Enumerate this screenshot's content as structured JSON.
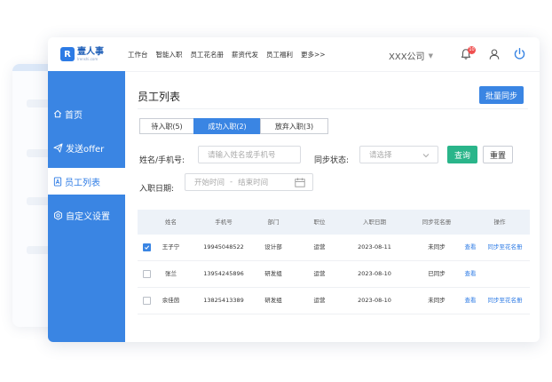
{
  "brand": {
    "name_cn": "壹人事",
    "name_en": "Irenshi.com",
    "mark": "R"
  },
  "nav": [
    "工作台",
    "智能入职",
    "员工花名册",
    "薪资代发",
    "员工福利",
    "更多>>"
  ],
  "company": "XXX公司",
  "notification_count": "10",
  "sidebar": [
    {
      "label": "首页",
      "icon": "home-icon"
    },
    {
      "label": "发送offer",
      "icon": "send-icon"
    },
    {
      "label": "员工列表",
      "icon": "document-icon"
    },
    {
      "label": "自定义设置",
      "icon": "settings-icon"
    }
  ],
  "page": {
    "title": "员工列表",
    "batch_sync": "批量同步"
  },
  "tabs": [
    "待入职(5)",
    "成功入职(2)",
    "放弃入职(3)"
  ],
  "active_tab_index": 1,
  "filters": {
    "name_label": "姓名/手机号:",
    "name_placeholder": "请输入姓名或手机号",
    "sync_label": "同步状态:",
    "sync_placeholder": "请选择",
    "query": "查询",
    "reset": "重置",
    "date_label": "入职日期:",
    "date_start": "开始时间",
    "date_sep": "-",
    "date_end": "结束时间"
  },
  "table": {
    "headers": [
      "姓名",
      "手机号",
      "部门",
      "职位",
      "入职日期",
      "同步花名册",
      "操作"
    ],
    "rows": [
      {
        "checked": true,
        "name": "王子宁",
        "phone": "19945048522",
        "dept": "设计部",
        "position": "运营",
        "date": "2023-08-11",
        "sync": "未同步",
        "view": "查看",
        "action": "同步至花名册"
      },
      {
        "checked": false,
        "name": "张兰",
        "phone": "13954245896",
        "dept": "研发组",
        "position": "运营",
        "date": "2023-08-10",
        "sync": "已同步",
        "view": "查看",
        "action": ""
      },
      {
        "checked": false,
        "name": "余佳茵",
        "phone": "13825413389",
        "dept": "研发组",
        "position": "运营",
        "date": "2023-08-10",
        "sync": "未同步",
        "view": "查看",
        "action": "同步至花名册"
      }
    ]
  },
  "colors": {
    "primary": "#3a85e3",
    "success": "#2ab58a",
    "badge": "#f05050"
  }
}
